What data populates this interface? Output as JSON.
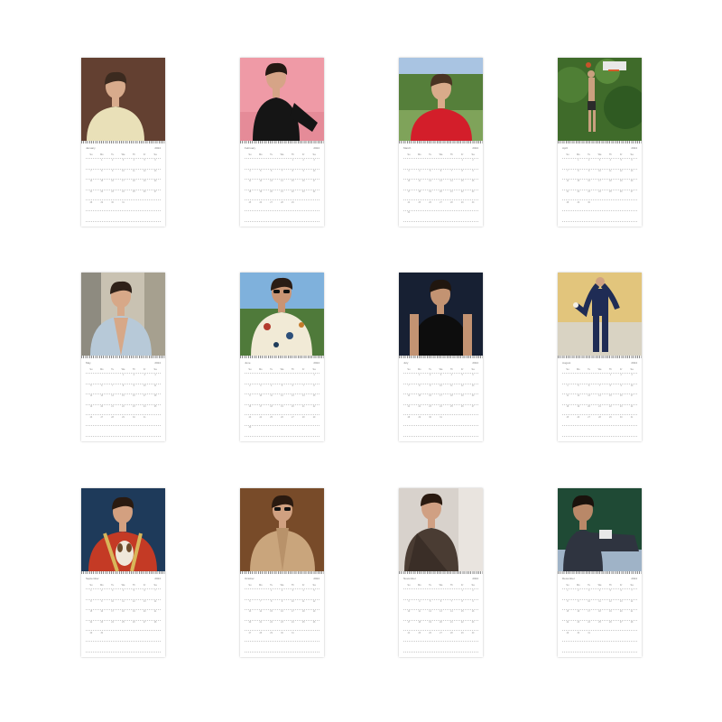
{
  "calendars": [
    {
      "month": "January",
      "year": "2024",
      "first_weekday": 1,
      "days_in_month": 31,
      "photo_icon": "portrait-cream-shirt"
    },
    {
      "month": "February",
      "year": "2024",
      "first_weekday": 4,
      "days_in_month": 29,
      "photo_icon": "portrait-pink-background"
    },
    {
      "month": "March",
      "year": "2024",
      "first_weekday": 5,
      "days_in_month": 31,
      "photo_icon": "portrait-red-shirt"
    },
    {
      "month": "April",
      "year": "2024",
      "first_weekday": 1,
      "days_in_month": 30,
      "photo_icon": "basketball-hoop-trees"
    },
    {
      "month": "May",
      "year": "2024",
      "first_weekday": 3,
      "days_in_month": 31,
      "photo_icon": "portrait-open-shirt"
    },
    {
      "month": "June",
      "year": "2024",
      "first_weekday": 6,
      "days_in_month": 30,
      "photo_icon": "portrait-sunglasses-hawaiian-shirt"
    },
    {
      "month": "July",
      "year": "2024",
      "first_weekday": 1,
      "days_in_month": 31,
      "photo_icon": "portrait-black-tank-top"
    },
    {
      "month": "August",
      "year": "2024",
      "first_weekday": 4,
      "days_in_month": 31,
      "photo_icon": "portrait-navy-suit"
    },
    {
      "month": "September",
      "year": "2024",
      "first_weekday": 0,
      "days_in_month": 30,
      "photo_icon": "portrait-with-puppy"
    },
    {
      "month": "October",
      "year": "2024",
      "first_weekday": 2,
      "days_in_month": 31,
      "photo_icon": "portrait-camel-coat-sunglasses"
    },
    {
      "month": "November",
      "year": "2024",
      "first_weekday": 5,
      "days_in_month": 30,
      "photo_icon": "portrait-leather-jacket"
    },
    {
      "month": "December",
      "year": "2024",
      "first_weekday": 0,
      "days_in_month": 31,
      "photo_icon": "portrait-reclining-dark"
    }
  ],
  "weekdays": [
    "Su",
    "Mo",
    "Tu",
    "We",
    "Th",
    "Fr",
    "Sa"
  ],
  "colors": {
    "page_background": "#ffffff",
    "grid_text": "#9a9a9a",
    "binding": "#8a8a8a"
  }
}
